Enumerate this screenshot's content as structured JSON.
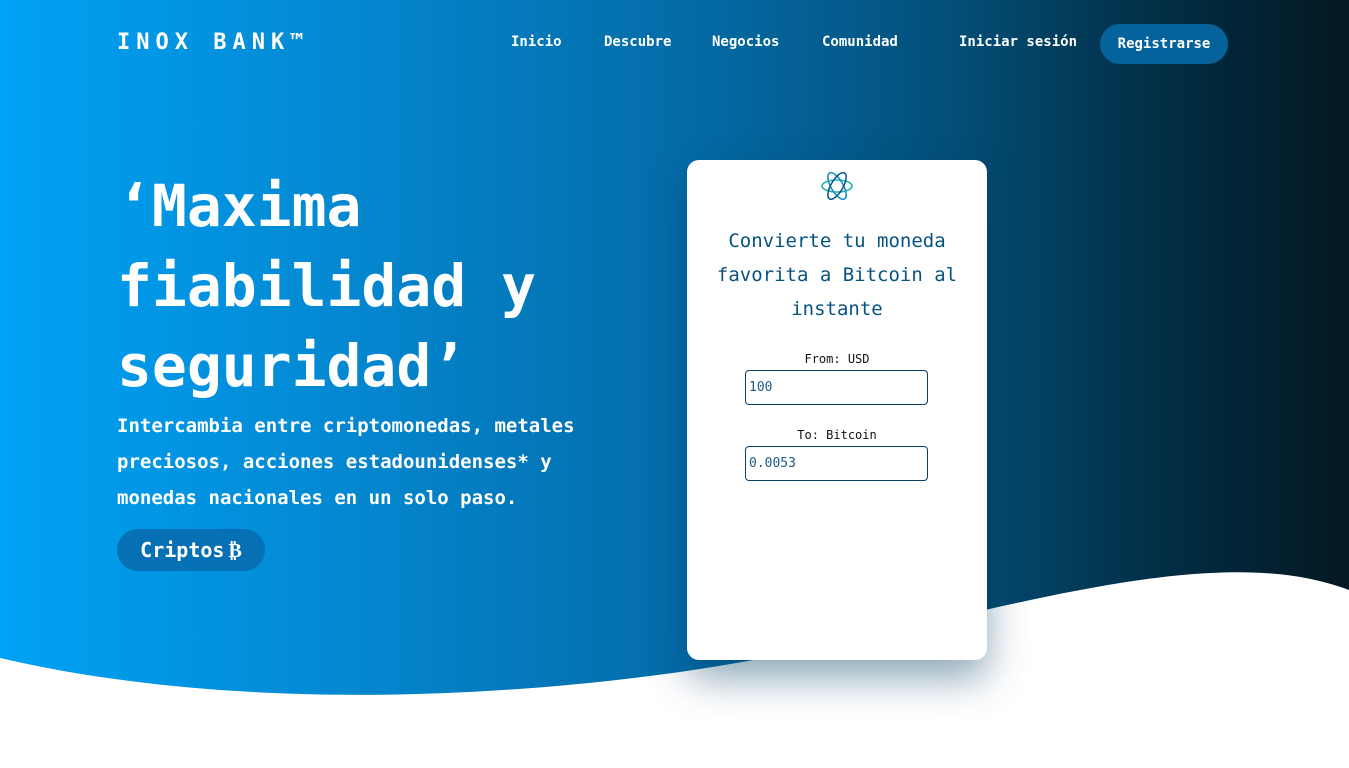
{
  "brand": {
    "logo": "INOX BANK™"
  },
  "nav": {
    "items": [
      {
        "label": "Inicio"
      },
      {
        "label": "Descubre"
      },
      {
        "label": "Negocios"
      },
      {
        "label": "Comunidad"
      }
    ],
    "login_label": "Iniciar sesión",
    "register_label": "Registrarse"
  },
  "hero": {
    "headline": "‘Maxima fiabilidad y seguridad’",
    "subtext": "Intercambia entre criptomonedas, metales preciosos, acciones estadounidenses* y monedas nacionales en un solo paso.",
    "cta_label": "Criptos",
    "cta_symbol": "₿"
  },
  "converter": {
    "icon": "atom-star-icon",
    "title": "Convierte tu moneda favorita a Bitcoin al instante",
    "from_label": "From: USD",
    "from_value": "100",
    "to_label": "To: Bitcoin",
    "to_value": "0.0053"
  },
  "colors": {
    "gradient_start": "#00a2f5",
    "gradient_end": "#031822",
    "button": "#05629a",
    "card_text": "#065382"
  }
}
